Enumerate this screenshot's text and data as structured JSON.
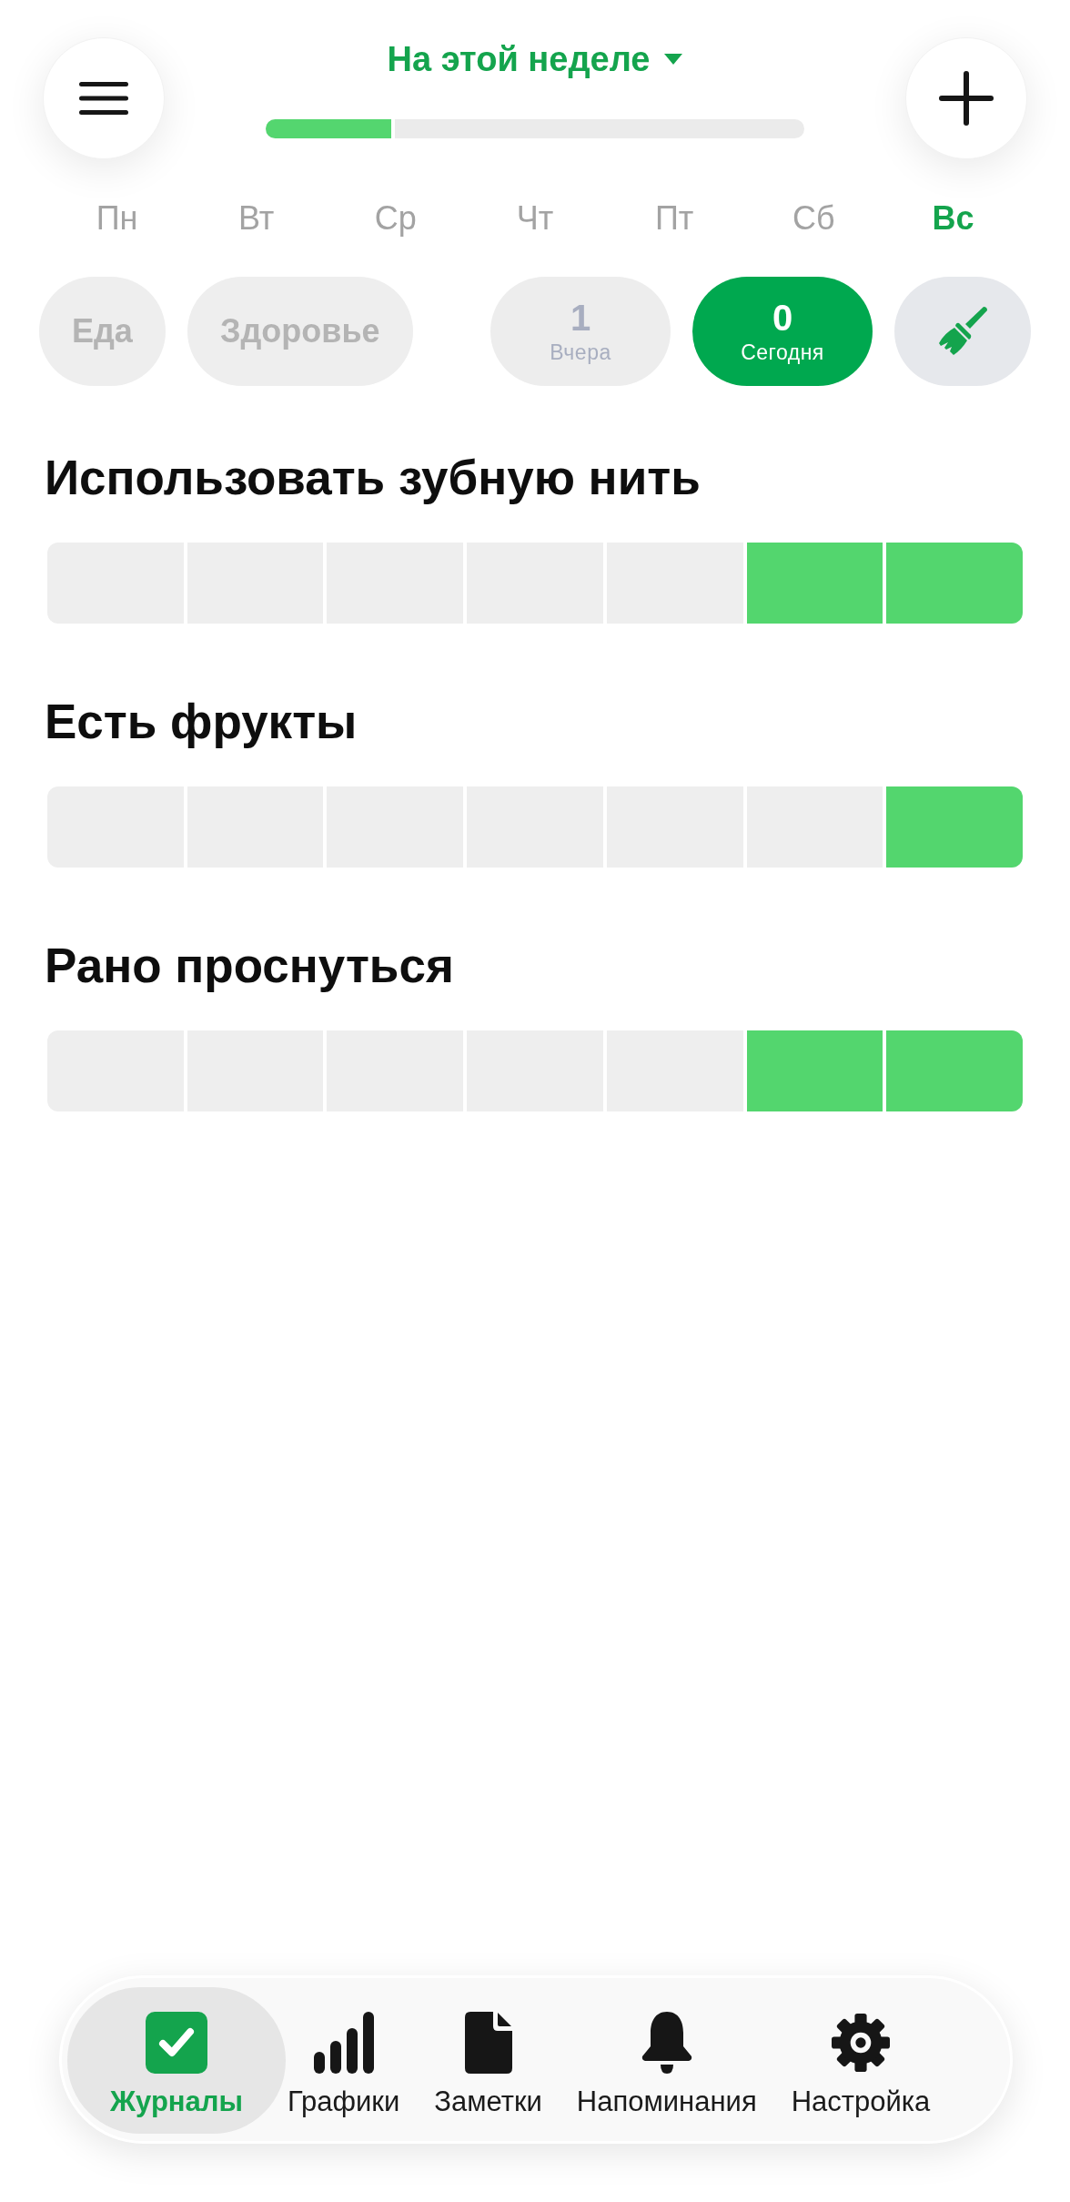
{
  "header": {
    "period": {
      "label": "На этой неделе"
    },
    "week_progress": {
      "level": 0.24
    }
  },
  "weekdays": [
    {
      "label": "Пн",
      "selected": false
    },
    {
      "label": "Вт",
      "selected": false
    },
    {
      "label": "Ср",
      "selected": false
    },
    {
      "label": "Чт",
      "selected": false
    },
    {
      "label": "Пт",
      "selected": false
    },
    {
      "label": "Сб",
      "selected": false
    },
    {
      "label": "Вс",
      "selected": true
    }
  ],
  "categories": [
    {
      "label": "Еда",
      "selected": false
    },
    {
      "label": "Здоровье",
      "selected": false
    }
  ],
  "day_toggle": [
    {
      "count": "1",
      "label": "Вчера",
      "selected": false
    },
    {
      "count": "0",
      "label": "Сегодня",
      "selected": true
    }
  ],
  "habits": [
    {
      "title": "Использовать зубную нить",
      "days": [
        {
          "done": false
        },
        {
          "done": false
        },
        {
          "done": false
        },
        {
          "done": false
        },
        {
          "done": false
        },
        {
          "done": true
        },
        {
          "done": true
        }
      ]
    },
    {
      "title": "Есть фрукты",
      "days": [
        {
          "done": false
        },
        {
          "done": false
        },
        {
          "done": false
        },
        {
          "done": false
        },
        {
          "done": false
        },
        {
          "done": false
        },
        {
          "done": true
        }
      ]
    },
    {
      "title": "Рано проснуться",
      "days": [
        {
          "done": false
        },
        {
          "done": false
        },
        {
          "done": false
        },
        {
          "done": false
        },
        {
          "done": false
        },
        {
          "done": true
        },
        {
          "done": true
        }
      ]
    }
  ],
  "nav": [
    {
      "label": "Журналы",
      "selected": true
    },
    {
      "label": "Графики",
      "selected": false
    },
    {
      "label": "Заметки",
      "selected": false
    },
    {
      "label": "Напоминания",
      "selected": false
    },
    {
      "label": "Настройка",
      "selected": false
    }
  ]
}
